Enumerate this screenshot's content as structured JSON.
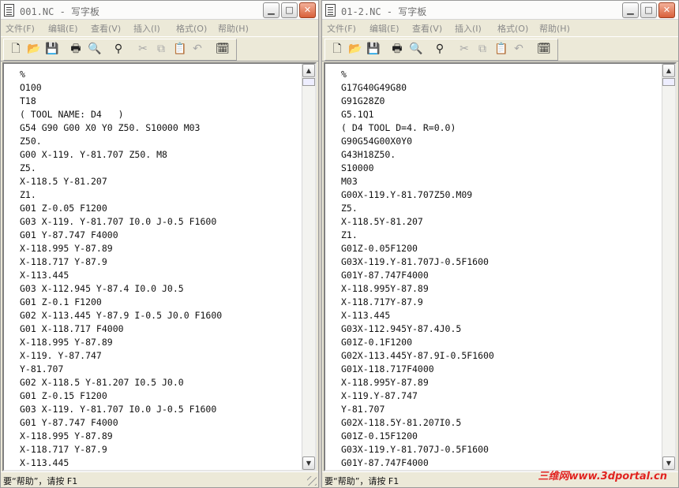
{
  "windows": [
    {
      "title": "001.NC - 写字板",
      "menus": [
        "文件(F)",
        "编辑(E)",
        "查看(V)",
        "插入(I)",
        "格式(O)",
        "帮助(H)"
      ],
      "lines": [
        "%",
        "O100",
        "T18",
        "( TOOL NAME: D4   )",
        "G54 G90 G00 X0 Y0 Z50. S10000 M03",
        "Z50.",
        "G00 X-119. Y-81.707 Z50. M8",
        "Z5.",
        "X-118.5 Y-81.207",
        "Z1.",
        "G01 Z-0.05 F1200",
        "G03 X-119. Y-81.707 I0.0 J-0.5 F1600",
        "G01 Y-87.747 F4000",
        "X-118.995 Y-87.89",
        "X-118.717 Y-87.9",
        "X-113.445",
        "G03 X-112.945 Y-87.4 I0.0 J0.5",
        "G01 Z-0.1 F1200",
        "G02 X-113.445 Y-87.9 I-0.5 J0.0 F1600",
        "G01 X-118.717 F4000",
        "X-118.995 Y-87.89",
        "X-119. Y-87.747",
        "Y-81.707",
        "G02 X-118.5 Y-81.207 I0.5 J0.0",
        "G01 Z-0.15 F1200",
        "G03 X-119. Y-81.707 I0.0 J-0.5 F1600",
        "G01 Y-87.747 F4000",
        "X-118.995 Y-87.89",
        "X-118.717 Y-87.9",
        "X-113.445"
      ],
      "status": "要“帮助”，请按 F1"
    },
    {
      "title": "01-2.NC - 写字板",
      "menus": [
        "文件(F)",
        "编辑(E)",
        "查看(V)",
        "插入(I)",
        "格式(O)",
        "帮助(H)"
      ],
      "lines": [
        "%",
        "G17G40G49G80",
        "G91G28Z0",
        "G5.1Q1",
        "( D4 TOOL D=4. R=0.0)",
        "G90G54G00X0Y0",
        "G43H18Z50.",
        "S10000",
        "M03",
        "G00X-119.Y-81.707Z50.M09",
        "Z5.",
        "X-118.5Y-81.207",
        "Z1.",
        "G01Z-0.05F1200",
        "G03X-119.Y-81.707J-0.5F1600",
        "G01Y-87.747F4000",
        "X-118.995Y-87.89",
        "X-118.717Y-87.9",
        "X-113.445",
        "G03X-112.945Y-87.4J0.5",
        "G01Z-0.1F1200",
        "G02X-113.445Y-87.9I-0.5F1600",
        "G01X-118.717F4000",
        "X-118.995Y-87.89",
        "X-119.Y-87.747",
        "Y-81.707",
        "G02X-118.5Y-81.207I0.5",
        "G01Z-0.15F1200",
        "G03X-119.Y-81.707J-0.5F1600",
        "G01Y-87.747F4000"
      ],
      "status": "要“帮助”，请按 F1"
    }
  ],
  "toolbar_icons": [
    "new-icon",
    "open-icon",
    "save-icon",
    "print-icon",
    "print-preview-icon",
    "find-icon",
    "cut-icon",
    "copy-icon",
    "paste-icon",
    "undo-icon",
    "insert-date-icon"
  ],
  "window_controls": [
    "minimize-icon",
    "maximize-icon",
    "close-icon"
  ],
  "watermark": "三维网www.3dportal.cn",
  "colors": {
    "watermark": "#e0231f",
    "editor_bg": "#ffffff",
    "chrome": "#ece9d8"
  }
}
